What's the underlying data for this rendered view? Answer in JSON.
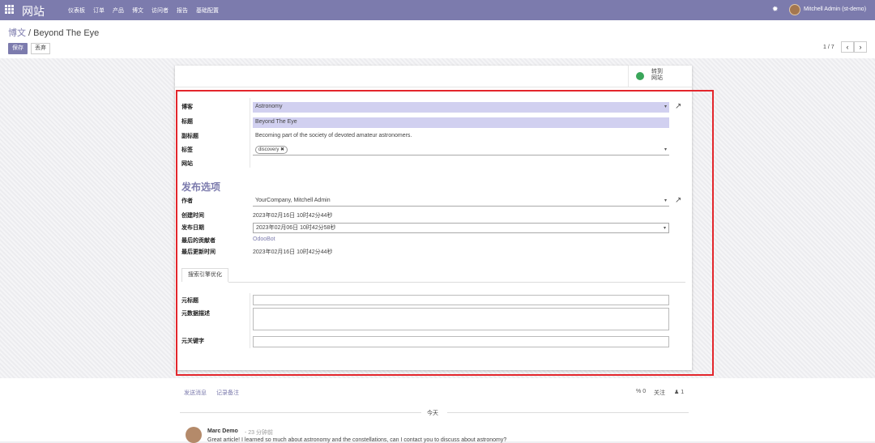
{
  "navbar": {
    "app_title": "网站",
    "menu": [
      "仪表板",
      "订单",
      "产品",
      "博文",
      "访问者",
      "报告",
      "基础配置"
    ],
    "user": "Mitchell Admin (st-demo)"
  },
  "breadcrumb": {
    "parent": "博文",
    "separator": " / ",
    "current": "Beyond The Eye"
  },
  "actions": {
    "save": "保存",
    "discard": "丢弃"
  },
  "pager": {
    "counter": "1 / 7",
    "prev": "‹",
    "next": "›"
  },
  "smart_button": {
    "line1": "转到",
    "line2": "网站"
  },
  "form": {
    "labels": {
      "blog": "博客",
      "title": "标题",
      "subtitle": "副标题",
      "tags": "标签",
      "website": "网站",
      "author": "作者",
      "created": "创建时间",
      "published": "发布日期",
      "last_contributor": "最后的贡献者",
      "last_updated": "最后更新时间",
      "meta_title": "元标题",
      "meta_description": "元数据描述",
      "meta_keywords": "元关键字"
    },
    "blog": "Astronomy",
    "title": "Beyond The Eye",
    "subtitle": "Becoming part of the society of devoted amateur astronomers.",
    "tag": "discovery",
    "section_title": "发布选项",
    "author": "YourCompany, Mitchell Admin",
    "created": "2023年02月16日 10时42分44秒",
    "published": "2023年02月06日 10时42分58秒",
    "last_contributor": "OdooBot",
    "last_updated": "2023年02月16日 10时42分44秒",
    "tab_label": "搜索引擎优化"
  },
  "chatter": {
    "send_message": "发送消息",
    "log_note": "记录备注",
    "attachments": "0",
    "follow": "关注",
    "followers": "1",
    "today": "今天",
    "author": "Marc Demo",
    "time": "- 23 分钟前",
    "body": "Great article! I learned so much about astronomy and the constellations, can I contact you to discuss about astronomy?"
  },
  "colors": {
    "brand": "#7c7bad",
    "highlight": "#d1d0f0",
    "annotation": "#e3262c"
  }
}
